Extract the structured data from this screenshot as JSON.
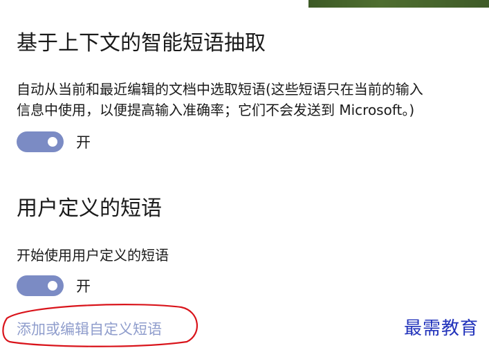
{
  "section1": {
    "title": "基于上下文的智能短语抽取",
    "description_line1": "自动从当前和最近编辑的文档中选取短语(这些短语只在当前的输入",
    "description_line2": "信息中使用，以便提高输入准确率；它们不会发送到 Microsoft。)",
    "toggle_state": true,
    "toggle_label": "开"
  },
  "section2": {
    "title": "用户定义的短语",
    "description": "开始使用用户定义的短语",
    "toggle_state": true,
    "toggle_label": "开",
    "link_label": "添加或编辑自定义短语"
  },
  "watermark": "最需教育",
  "colors": {
    "toggle_on": "#7b8bc4",
    "link": "#8f9dcc",
    "annotation": "#d9141b",
    "watermark": "#2233bb"
  }
}
